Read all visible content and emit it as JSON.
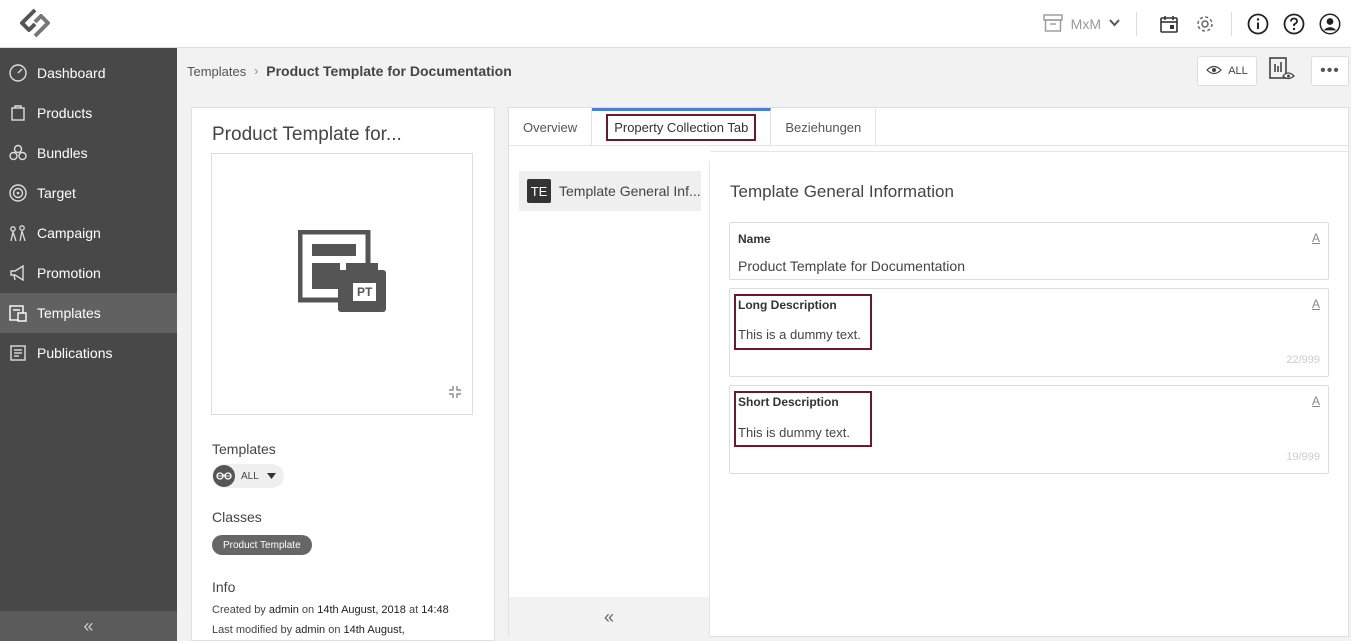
{
  "topbar": {
    "workspace": "MxM",
    "icons": [
      "archive-icon",
      "calendar-icon",
      "gear-icon",
      "info-icon",
      "help-icon",
      "user-icon"
    ]
  },
  "sidebar": {
    "items": [
      {
        "label": "Dashboard",
        "icon": "dashboard-icon"
      },
      {
        "label": "Products",
        "icon": "products-icon"
      },
      {
        "label": "Bundles",
        "icon": "bundles-icon"
      },
      {
        "label": "Target",
        "icon": "target-icon"
      },
      {
        "label": "Campaign",
        "icon": "campaign-icon"
      },
      {
        "label": "Promotion",
        "icon": "promotion-icon"
      },
      {
        "label": "Templates",
        "icon": "templates-icon",
        "active": true
      },
      {
        "label": "Publications",
        "icon": "publications-icon"
      }
    ],
    "collapse": "«"
  },
  "breadcrumb": {
    "parent": "Templates",
    "separator": "›",
    "current": "Product Template for Documentation"
  },
  "header_actions": {
    "all_label": "ALL",
    "more": "•••"
  },
  "left_panel": {
    "title": "Product Template for...",
    "image_label": "PT",
    "templates_label": "Templates",
    "templates_chip": "ALL",
    "classes_label": "Classes",
    "class_chip": "Product Template",
    "info_label": "Info",
    "created": {
      "prefix": "Created by",
      "user": "admin",
      "on": "on",
      "date": "14th August, 2018",
      "at": "at",
      "time": "14:48"
    },
    "modified": {
      "prefix": "Last modified by",
      "user": "admin",
      "on": "on",
      "date": "14th August,"
    }
  },
  "main": {
    "tabs": [
      {
        "label": "Overview"
      },
      {
        "label": "Property Collection Tab",
        "active": true
      },
      {
        "label": "Beziehungen"
      }
    ],
    "section_badge": "TE",
    "section_item": "Template General Inf...",
    "section_collapse": "«",
    "section_title": "Template General Information",
    "fields": {
      "name": {
        "label": "Name",
        "value": "Product Template for Documentation",
        "lang": "A"
      },
      "long_description": {
        "label": "Long Description",
        "value": "This is a dummy text.",
        "lang": "A",
        "count": "22/999"
      },
      "short_description": {
        "label": "Short Description",
        "value": "This is dummy text.",
        "lang": "A",
        "count": "19/999"
      }
    }
  },
  "colors": {
    "sidebar_bg": "#484848",
    "sidebar_active": "#616161",
    "tab_accent": "#4a7fd4",
    "highlight_border": "#6a1a2a"
  }
}
